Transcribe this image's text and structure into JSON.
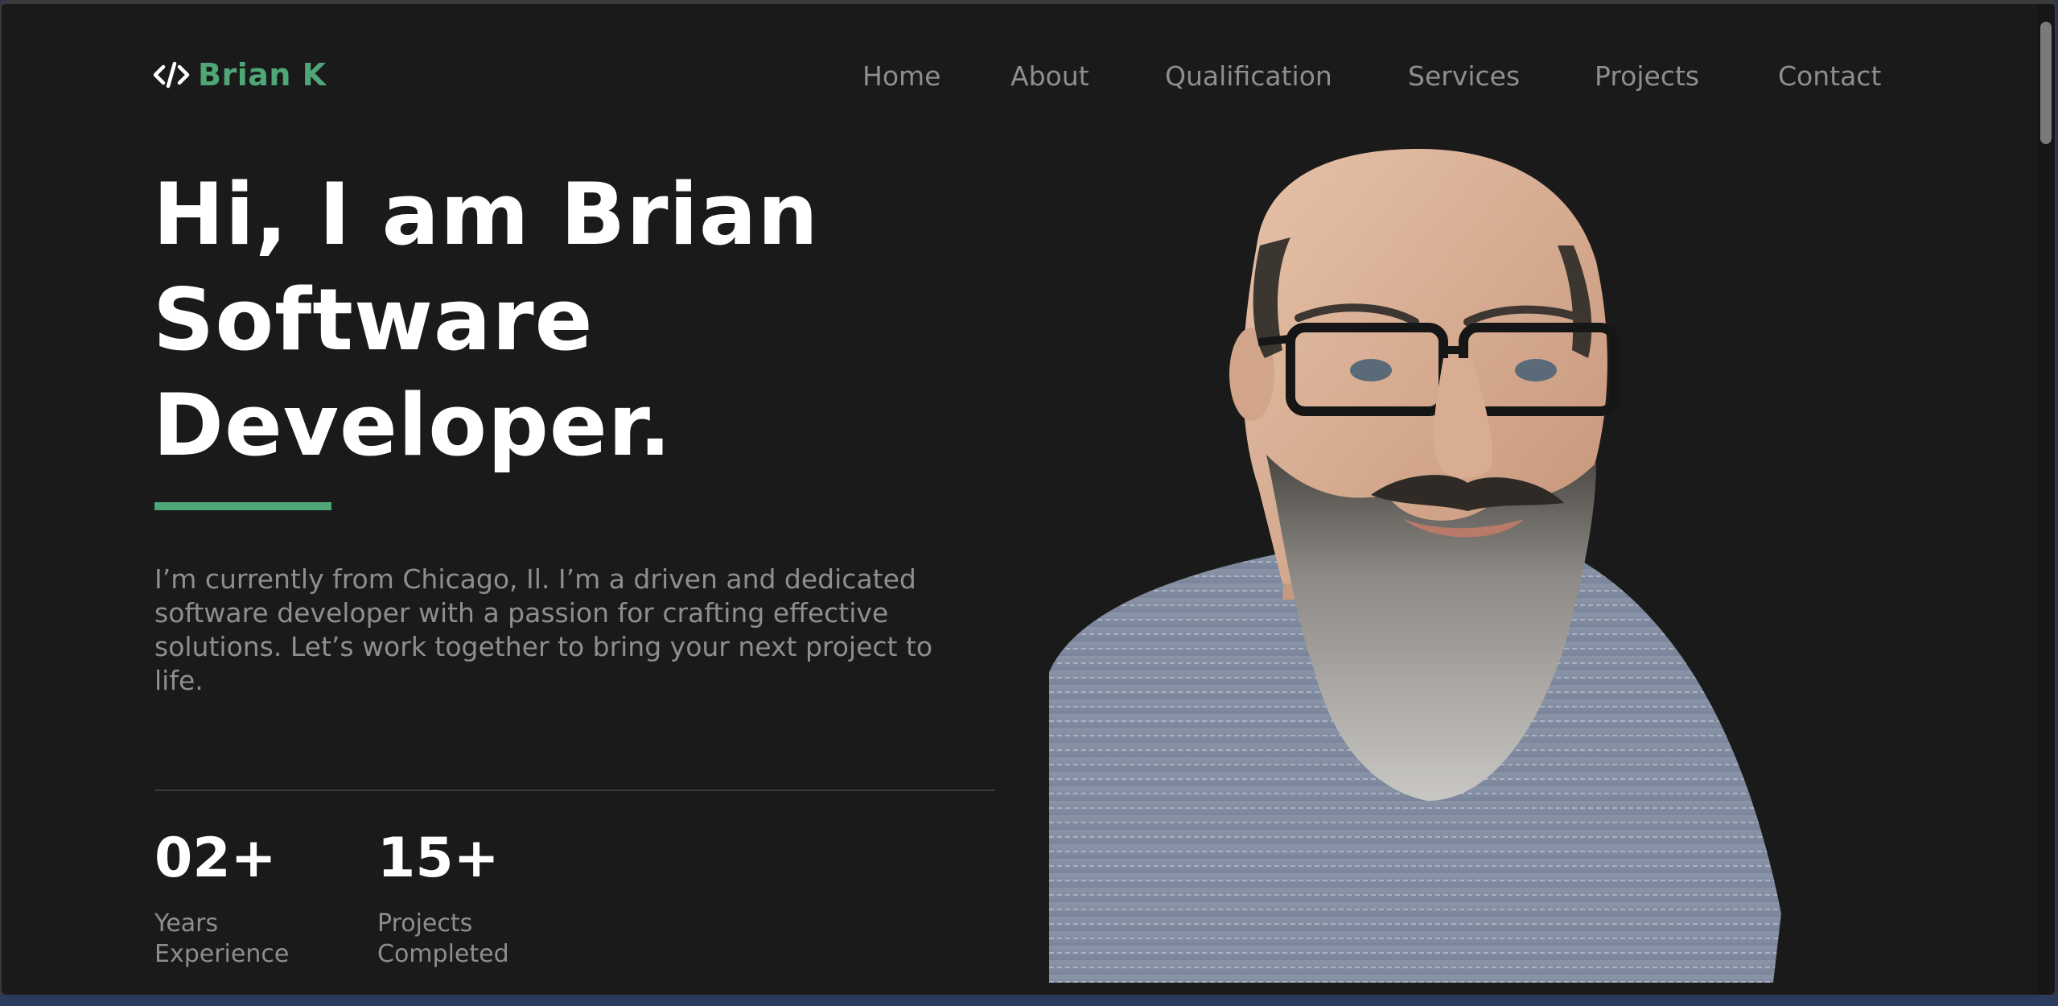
{
  "header": {
    "logo_text": "Brian K",
    "logo_icon": "code-icon",
    "nav": [
      {
        "label": "Home"
      },
      {
        "label": "About"
      },
      {
        "label": "Qualification"
      },
      {
        "label": "Services"
      },
      {
        "label": "Projects"
      },
      {
        "label": "Contact"
      }
    ]
  },
  "hero": {
    "title_lines": [
      "Hi, I am Brian",
      "Software",
      "Developer."
    ],
    "description": "I’m currently from Chicago, Il. I’m a driven and dedicated software developer with a passion for crafting effective solutions. Let’s work together to bring your next project to life.",
    "portrait_alt": "portrait-photo"
  },
  "stats": [
    {
      "value": "02+",
      "label": "Years\nExperience"
    },
    {
      "value": "15+",
      "label": "Projects\nCompleted"
    }
  ],
  "colors": {
    "background": "#1a1a1a",
    "accent": "#4fa677",
    "heading": "#ffffff",
    "muted": "#8e8e8e"
  }
}
